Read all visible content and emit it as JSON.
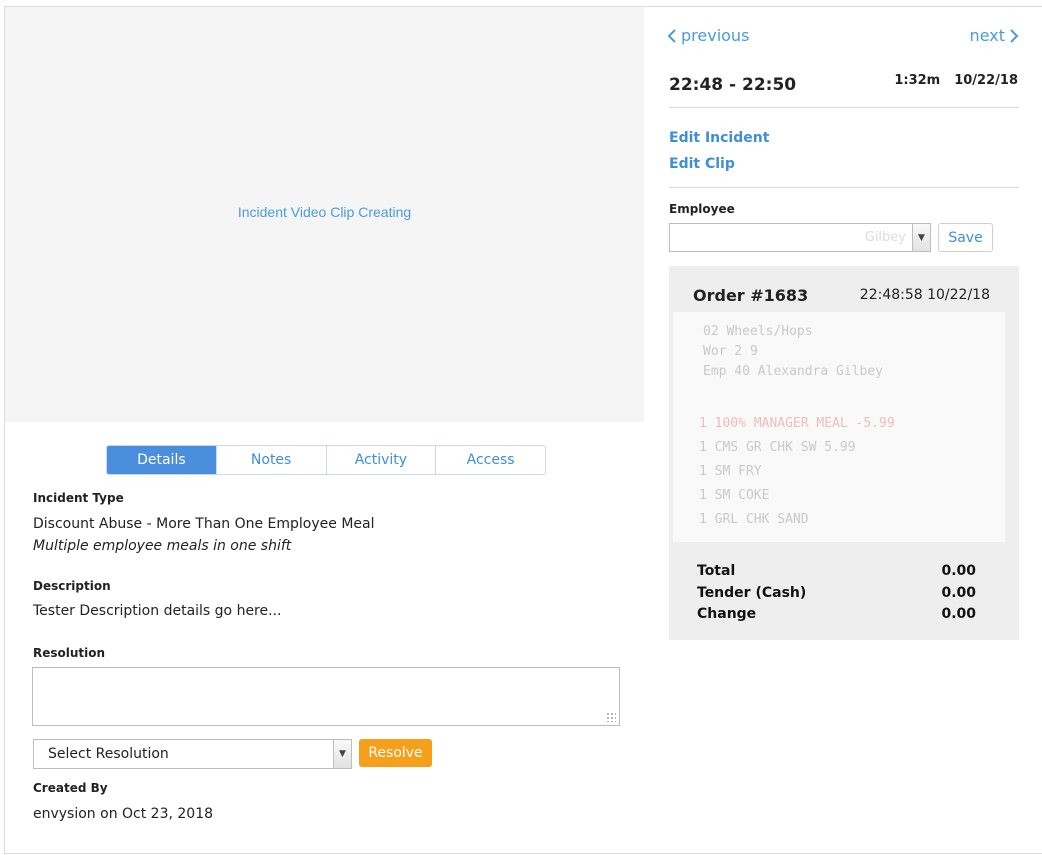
{
  "video": {
    "status_text": "Incident Video Clip Creating"
  },
  "tabs": [
    {
      "label": "Details",
      "active": true
    },
    {
      "label": "Notes",
      "active": false
    },
    {
      "label": "Activity",
      "active": false
    },
    {
      "label": "Access",
      "active": false
    }
  ],
  "details": {
    "incident_type_label": "Incident Type",
    "incident_type_value": "Discount Abuse - More Than One Employee Meal",
    "incident_type_subtext": "Multiple employee meals in one shift",
    "description_label": "Description",
    "description_value": "Tester Description details go here...",
    "resolution_label": "Resolution",
    "resolution_text": "",
    "resolution_select": "Select Resolution",
    "resolve_button": "Resolve",
    "created_by_label": "Created By",
    "created_by_value": "envysion on Oct 23, 2018"
  },
  "nav": {
    "previous": "previous",
    "next": "next"
  },
  "clip": {
    "time_range": "22:48 - 22:50",
    "duration": "1:32m",
    "date": "10/22/18"
  },
  "actions": {
    "edit_incident": "Edit Incident",
    "edit_clip": "Edit Clip"
  },
  "employee": {
    "label": "Employee",
    "selected": "Gilbey",
    "save_button": "Save"
  },
  "order": {
    "title": "Order #1683",
    "timestamp": "22:48:58 10/22/18",
    "receipt_lines": [
      {
        "text": "02 Wheels/Hops",
        "red": false
      },
      {
        "text": "Wor 2 9",
        "red": false
      },
      {
        "text": "Emp 40 Alexandra Gilbey",
        "red": false
      },
      {
        "text": "1    100% MANAGER MEAL   -5.99",
        "red": true
      },
      {
        "text": "1    CMS GR CHK SW        5.99",
        "red": false
      },
      {
        "text": "1    SM FRY",
        "red": false
      },
      {
        "text": "1    SM COKE",
        "red": false
      },
      {
        "text": "1    GRL CHK SAND",
        "red": false
      }
    ],
    "totals": [
      {
        "label": "Total",
        "value": "0.00"
      },
      {
        "label": "Tender (Cash)",
        "value": "0.00"
      },
      {
        "label": "Change",
        "value": "0.00"
      }
    ]
  },
  "colors": {
    "accent": "#4a8fde",
    "link": "#3f8fd6",
    "resolve": "#f59f1b"
  }
}
